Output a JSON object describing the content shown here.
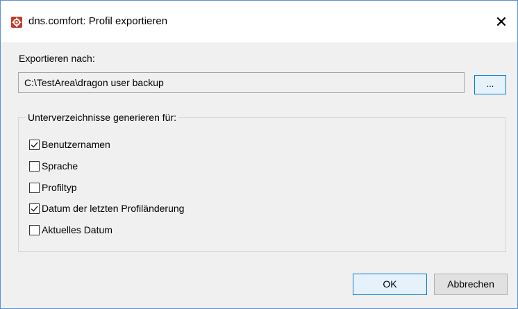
{
  "window": {
    "title": "dns.comfort: Profil exportieren",
    "close_glyph": "✕",
    "app_icon": "gear-icon",
    "accent_color": "#0078d7",
    "icon_color": "#c0392b"
  },
  "export": {
    "label": "Exportieren nach:",
    "path_value": "C:\\TestArea\\dragon user backup",
    "browse_label": "..."
  },
  "subdirs": {
    "group_label": "Unterverzeichnisse generieren für:",
    "options": [
      {
        "label": "Benutzernamen",
        "checked": true
      },
      {
        "label": "Sprache",
        "checked": false
      },
      {
        "label": "Profiltyp",
        "checked": false
      },
      {
        "label": "Datum der letzten Profiländerung",
        "checked": true
      },
      {
        "label": "Aktuelles Datum",
        "checked": false
      }
    ]
  },
  "buttons": {
    "ok": "OK",
    "cancel": "Abbrechen"
  }
}
